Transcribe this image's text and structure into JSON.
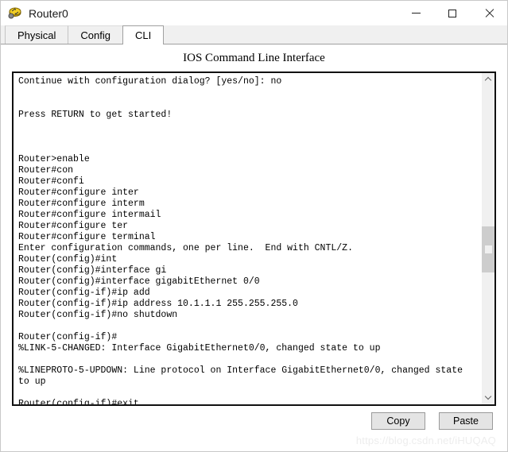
{
  "window": {
    "title": "Router0",
    "icon": "router-icon",
    "controls": {
      "minimize": "minimize-icon",
      "maximize": "maximize-icon",
      "close": "close-icon"
    }
  },
  "tabs": [
    {
      "label": "Physical",
      "active": false
    },
    {
      "label": "Config",
      "active": false
    },
    {
      "label": "CLI",
      "active": true
    }
  ],
  "cli": {
    "heading": "IOS Command Line Interface",
    "lines": [
      "Continue with configuration dialog? [yes/no]: no",
      "",
      "",
      "Press RETURN to get started!",
      "",
      "",
      "",
      "Router>enable",
      "Router#con",
      "Router#confi",
      "Router#configure inter",
      "Router#configure interm",
      "Router#configure intermail",
      "Router#configure ter",
      "Router#configure terminal",
      "Enter configuration commands, one per line.  End with CNTL/Z.",
      "Router(config)#int",
      "Router(config)#interface gi",
      "Router(config)#interface gigabitEthernet 0/0",
      "Router(config-if)#ip add",
      "Router(config-if)#ip address 10.1.1.1 255.255.255.0",
      "Router(config-if)#no shutdown",
      "",
      "Router(config-if)#",
      "%LINK-5-CHANGED: Interface GigabitEthernet0/0, changed state to up",
      "",
      "%LINEPROTO-5-UPDOWN: Line protocol on Interface GigabitEthernet0/0, changed state",
      "to up",
      "",
      "Router(config-if)#exit"
    ]
  },
  "scrollbar": {
    "up_arrow": "chevron-up-icon",
    "down_arrow": "chevron-down-icon",
    "thumb_top_pct": 46,
    "thumb_height_pct": 15
  },
  "buttons": {
    "copy": "Copy",
    "paste": "Paste"
  },
  "watermark": "https://blog.csdn.net/iHUQAQ"
}
